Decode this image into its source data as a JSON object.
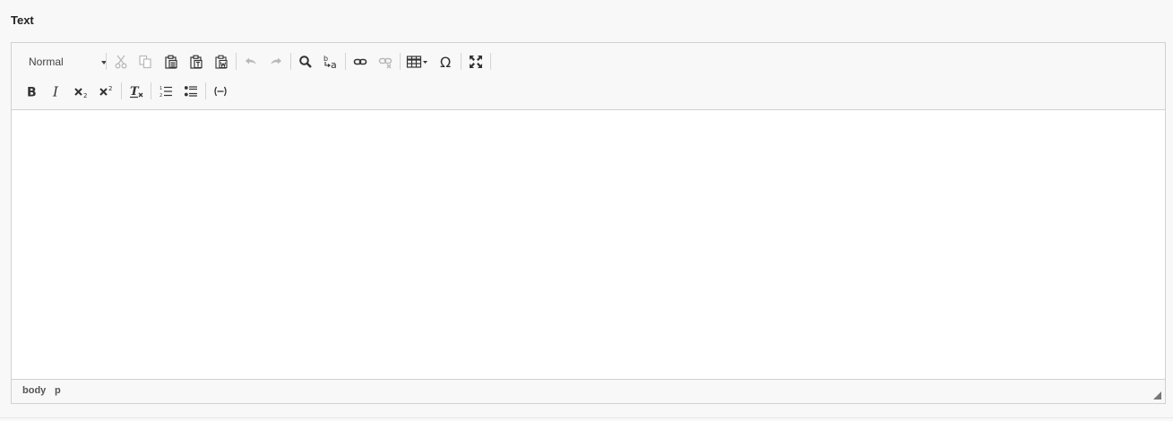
{
  "field": {
    "label": "Text"
  },
  "toolbar": {
    "format_combo": {
      "selected": "Normal"
    },
    "row1_icons": [
      "cut-icon",
      "copy-icon",
      "paste-icon",
      "paste-text-icon",
      "paste-word-icon",
      "undo-icon",
      "redo-icon",
      "find-icon",
      "replace-icon",
      "link-icon",
      "unlink-icon",
      "table-icon",
      "special-char-icon",
      "maximize-icon"
    ],
    "row2_icons": [
      "bold-icon",
      "italic-icon",
      "subscript-icon",
      "superscript-icon",
      "remove-format-icon",
      "numbered-list-icon",
      "bulleted-list-icon",
      "placeholder-icon"
    ],
    "disabled": [
      "cut",
      "copy",
      "undo",
      "redo",
      "unlink"
    ]
  },
  "statusbar": {
    "path": [
      "body",
      "p"
    ]
  },
  "colors": {
    "toolbar_bg": "#f8f8f8",
    "border": "#d1d1d1",
    "icon": "#333333",
    "icon_disabled": "#b8b8b8"
  }
}
